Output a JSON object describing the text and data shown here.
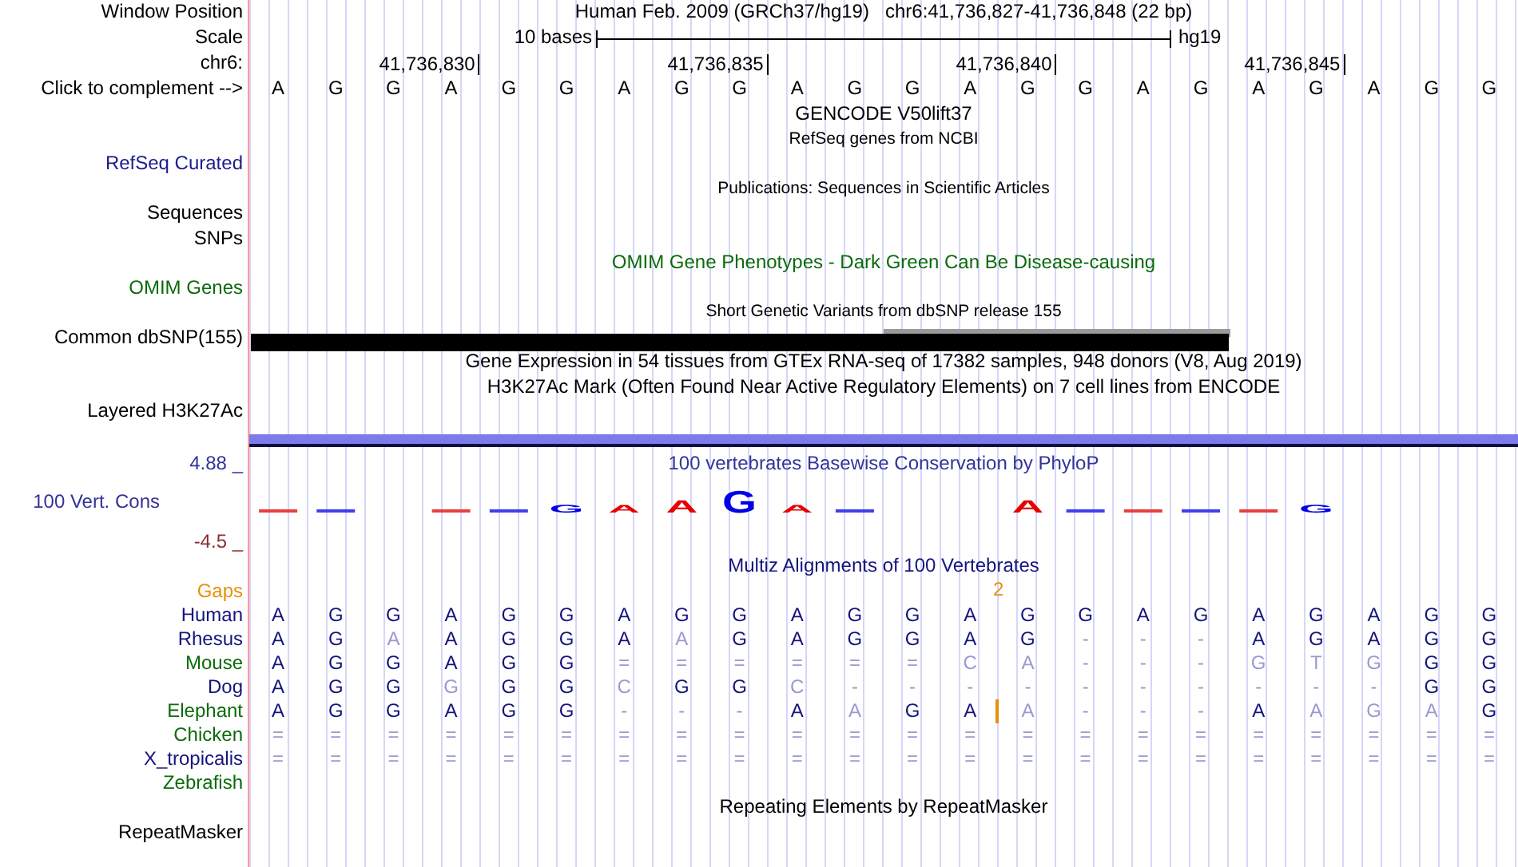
{
  "window_position": {
    "label": "Window Position",
    "assembly": "Human Feb. 2009 (GRCh37/hg19)",
    "range": "chr6:41,736,827-41,736,848 (22 bp)"
  },
  "scale": {
    "label": "Scale",
    "length": "10 bases",
    "assembly": "hg19"
  },
  "ruler": {
    "label": "chr6:",
    "ticks": [
      "41,736,830",
      "41,736,835",
      "41,736,840",
      "41,736,845"
    ]
  },
  "sequence": {
    "label": "Click to complement -->",
    "bases": [
      "A",
      "G",
      "G",
      "A",
      "G",
      "G",
      "A",
      "G",
      "G",
      "A",
      "G",
      "G",
      "A",
      "G",
      "G",
      "A",
      "G",
      "A",
      "G",
      "A",
      "G",
      "G"
    ]
  },
  "tracks": [
    {
      "kind": "title",
      "text": "GENCODE V50lift37",
      "color": "#000000"
    },
    {
      "kind": "subtitle",
      "text": "RefSeq genes from NCBI",
      "color": "#000000"
    },
    {
      "kind": "label",
      "text": "RefSeq Curated",
      "color": "#1c1c8c"
    },
    {
      "kind": "subtitle",
      "text": "Publications: Sequences in Scientific Articles",
      "color": "#000000"
    },
    {
      "kind": "label",
      "text": "Sequences",
      "color": "#000000"
    },
    {
      "kind": "label",
      "text": "SNPs",
      "color": "#000000"
    },
    {
      "kind": "title",
      "text": "OMIM Gene Phenotypes - Dark Green Can Be Disease-causing",
      "color": "#0b6b0b"
    },
    {
      "kind": "label",
      "text": "OMIM Genes",
      "color": "#0b6b0b"
    },
    {
      "kind": "subtitle",
      "text": "Short Genetic Variants from dbSNP release 155",
      "color": "#000000"
    },
    {
      "kind": "snp",
      "text": "Common dbSNP(155)",
      "color": "#000000"
    },
    {
      "kind": "title",
      "text": "Gene Expression in 54 tissues from GTEx RNA-seq of 17382 samples, 948 donors (V8, Aug 2019)",
      "color": "#000000"
    },
    {
      "kind": "title",
      "text": "H3K27Ac Mark (Often Found Near Active Regulatory Elements) on 7 cell lines from ENCODE",
      "color": "#000000"
    },
    {
      "kind": "label",
      "text": "Layered H3K27Ac",
      "color": "#000000"
    },
    {
      "kind": "signal"
    }
  ],
  "conservation": {
    "title": "100 vertebrates Basewise Conservation by PhyloP",
    "label": "100 Vert. Cons",
    "max": "4.88 _",
    "min": "-4.5 _",
    "logo": [
      {
        "kind": "dash",
        "color": "#e84040"
      },
      {
        "kind": "dash",
        "color": "#4040e8"
      },
      {
        "kind": "none"
      },
      {
        "kind": "dash",
        "color": "#e84040"
      },
      {
        "kind": "dash",
        "color": "#4040e8"
      },
      {
        "kind": "small",
        "letter": "G"
      },
      {
        "kind": "small",
        "letter": "A"
      },
      {
        "kind": "medium",
        "letter": "A"
      },
      {
        "kind": "big",
        "letter": "G"
      },
      {
        "kind": "small",
        "letter": "A"
      },
      {
        "kind": "dash",
        "color": "#4040e8"
      },
      {
        "kind": "none"
      },
      {
        "kind": "none"
      },
      {
        "kind": "medium",
        "letter": "A"
      },
      {
        "kind": "dash",
        "color": "#4040e8"
      },
      {
        "kind": "dash",
        "color": "#e84040"
      },
      {
        "kind": "dash",
        "color": "#4040e8"
      },
      {
        "kind": "dash",
        "color": "#e84040"
      },
      {
        "kind": "small",
        "letter": "G"
      },
      {
        "kind": "none"
      },
      {
        "kind": "none"
      },
      {
        "kind": "none"
      }
    ]
  },
  "alignment": {
    "title": "Multiz Alignments of 100 Vertebrates",
    "gaps": {
      "label": "Gaps",
      "count": "2"
    },
    "species": [
      {
        "name": "Human",
        "color": "#14147d",
        "bases": [
          "A",
          "G",
          "G",
          "A",
          "G",
          "G",
          "A",
          "G",
          "G",
          "A",
          "G",
          "G",
          "A",
          "G",
          "G",
          "A",
          "G",
          "A",
          "G",
          "A",
          "G",
          "G"
        ],
        "light": [
          false,
          false,
          false,
          false,
          false,
          false,
          false,
          false,
          false,
          false,
          false,
          false,
          false,
          false,
          false,
          false,
          false,
          false,
          false,
          false,
          false,
          false
        ]
      },
      {
        "name": "Rhesus",
        "color": "#14147d",
        "bases": [
          "A",
          "G",
          "A",
          "A",
          "G",
          "G",
          "A",
          "A",
          "G",
          "A",
          "G",
          "G",
          "A",
          "G",
          "-",
          "-",
          "-",
          "A",
          "G",
          "A",
          "G",
          "G"
        ],
        "light": [
          false,
          false,
          true,
          false,
          false,
          false,
          false,
          true,
          false,
          false,
          false,
          false,
          false,
          false,
          true,
          true,
          true,
          false,
          false,
          false,
          false,
          false
        ]
      },
      {
        "name": "Mouse",
        "color": "#0b6b0b",
        "bases": [
          "A",
          "G",
          "G",
          "A",
          "G",
          "G",
          "=",
          "=",
          "=",
          "=",
          "=",
          "=",
          "C",
          "A",
          "-",
          "-",
          "-",
          "G",
          "T",
          "G",
          "G",
          "G"
        ],
        "light": [
          false,
          false,
          false,
          false,
          false,
          false,
          true,
          true,
          true,
          true,
          true,
          true,
          true,
          true,
          true,
          true,
          true,
          true,
          true,
          true,
          false,
          false
        ]
      },
      {
        "name": "Dog",
        "color": "#14147d",
        "bases": [
          "A",
          "G",
          "G",
          "G",
          "G",
          "G",
          "C",
          "G",
          "G",
          "C",
          "-",
          "-",
          "-",
          "-",
          "-",
          "-",
          "-",
          "-",
          "-",
          "-",
          "G",
          "G"
        ],
        "light": [
          false,
          false,
          false,
          true,
          false,
          false,
          true,
          false,
          false,
          true,
          true,
          true,
          true,
          true,
          true,
          true,
          true,
          true,
          true,
          true,
          false,
          false
        ]
      },
      {
        "name": "Elephant",
        "color": "#0b6b0b",
        "bases": [
          "A",
          "G",
          "G",
          "A",
          "G",
          "G",
          "-",
          "-",
          "-",
          "A",
          "A",
          "G",
          "A",
          "A",
          "-",
          "-",
          "-",
          "A",
          "A",
          "G",
          "A",
          "G"
        ],
        "light": [
          false,
          false,
          false,
          false,
          false,
          false,
          true,
          true,
          true,
          false,
          true,
          false,
          false,
          true,
          true,
          true,
          true,
          false,
          true,
          true,
          true,
          false
        ],
        "insert": [
          false,
          false,
          false,
          false,
          false,
          false,
          false,
          false,
          false,
          false,
          false,
          false,
          true,
          false,
          false,
          false,
          false,
          false,
          false,
          false,
          false,
          false
        ]
      },
      {
        "name": "Chicken",
        "color": "#0b6b0b",
        "bases": [
          "=",
          "=",
          "=",
          "=",
          "=",
          "=",
          "=",
          "=",
          "=",
          "=",
          "=",
          "=",
          "=",
          "=",
          "=",
          "=",
          "=",
          "=",
          "=",
          "=",
          "=",
          "="
        ],
        "light": [
          true,
          true,
          true,
          true,
          true,
          true,
          true,
          true,
          true,
          true,
          true,
          true,
          true,
          true,
          true,
          true,
          true,
          true,
          true,
          true,
          true,
          true
        ]
      },
      {
        "name": "X_tropicalis",
        "color": "#14147d",
        "bases": [
          "=",
          "=",
          "=",
          "=",
          "=",
          "=",
          "=",
          "=",
          "=",
          "=",
          "=",
          "=",
          "=",
          "=",
          "=",
          "=",
          "=",
          "=",
          "=",
          "=",
          "=",
          "="
        ],
        "light": [
          true,
          true,
          true,
          true,
          true,
          true,
          true,
          true,
          true,
          true,
          true,
          true,
          true,
          true,
          true,
          true,
          true,
          true,
          true,
          true,
          true,
          true
        ]
      },
      {
        "name": "Zebrafish",
        "color": "#0b6b0b"
      }
    ]
  },
  "repeats": {
    "title": "Repeating Elements by RepeatMasker",
    "label": "RepeatMasker"
  }
}
